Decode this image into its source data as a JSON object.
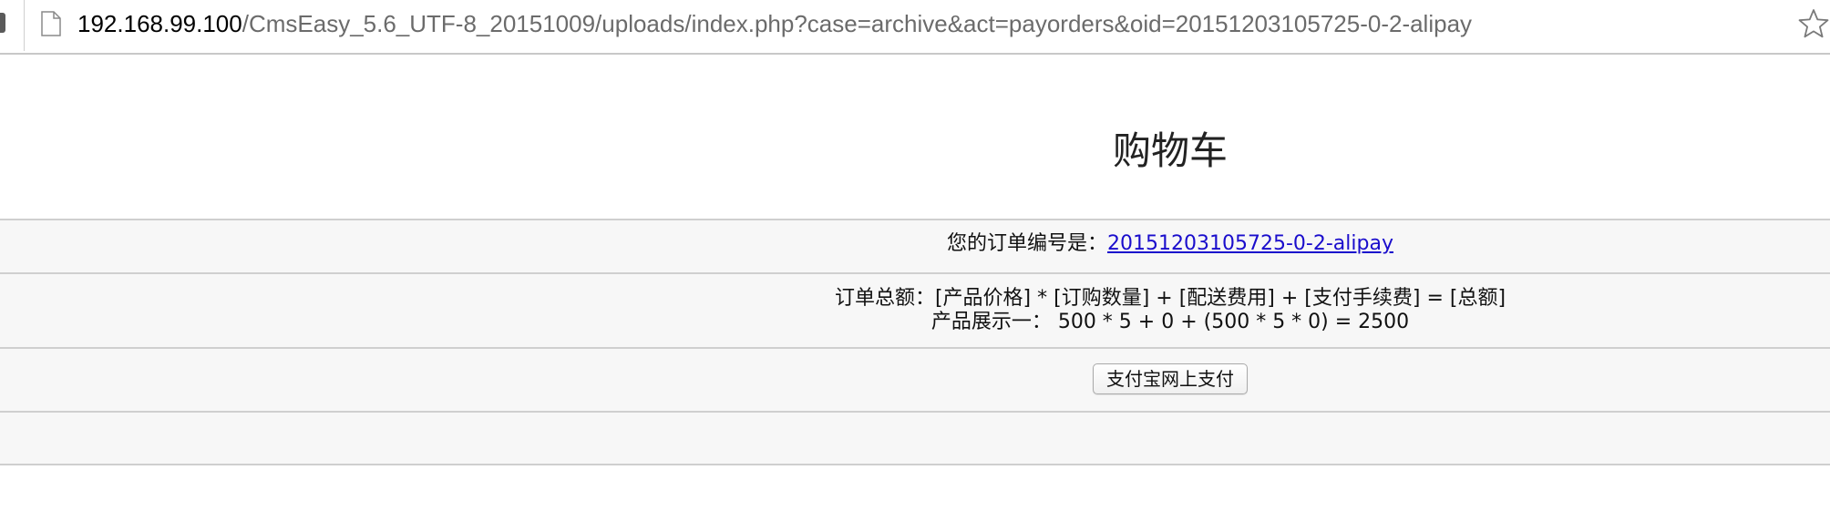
{
  "browser": {
    "url_host": "192.168.99.100",
    "url_path": "/CmsEasy_5.6_UTF-8_20151009/uploads/index.php?case=archive&act=payorders&oid=20151203105725-0-2-alipay",
    "page_icon": "document-icon",
    "bookmark_icon": "star-icon"
  },
  "page": {
    "title": "购物车"
  },
  "order": {
    "number_label": "您的订单编号是：",
    "number_value": "20151203105725-0-2-alipay",
    "formula_line": "订单总额：[产品价格] * [订购数量] + [配送费用] + [支付手续费] = [总额]",
    "product_line": "产品展示一：  500 * 5 + 0 + (500 * 5 * 0) = 2500",
    "pay_button_label": "支付宝网上支付"
  }
}
